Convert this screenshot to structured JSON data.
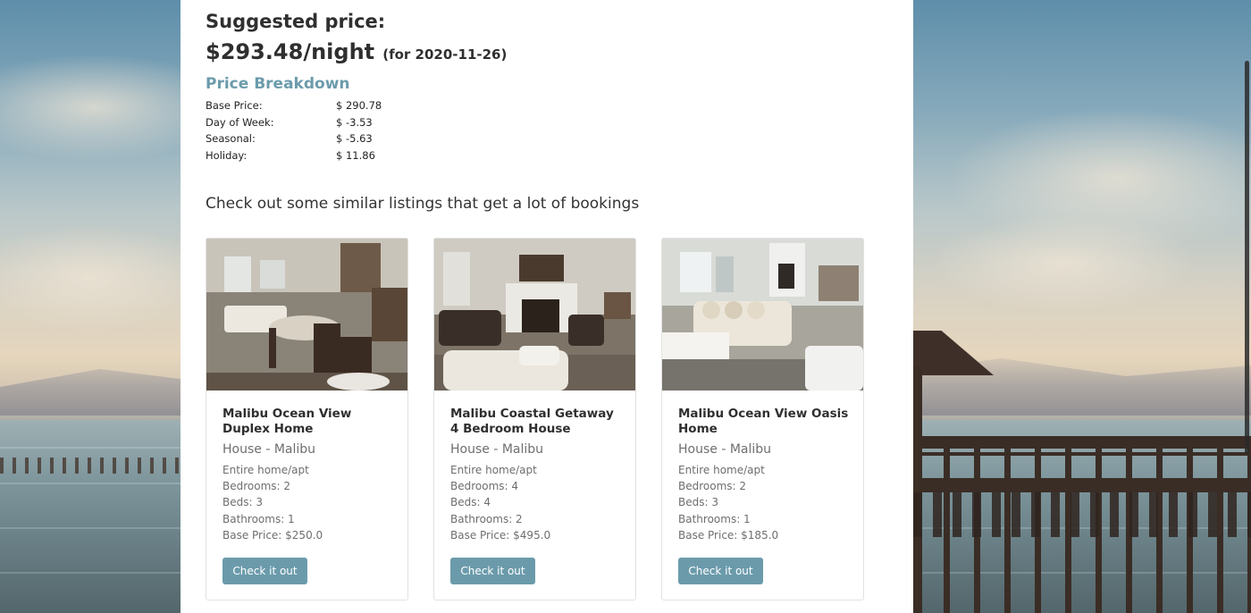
{
  "pricing": {
    "suggested_label": "Suggested price:",
    "price": "$293.48/night",
    "date_note": "(for 2020-11-26)",
    "breakdown_title": "Price Breakdown",
    "breakdown": [
      {
        "label": "Base Price:",
        "value": "$ 290.78"
      },
      {
        "label": "Day of Week:",
        "value": "$ -3.53"
      },
      {
        "label": "Seasonal:",
        "value": "$ -5.63"
      },
      {
        "label": "Holiday:",
        "value": "$ 11.86"
      }
    ]
  },
  "similar": {
    "heading": "Check out some similar listings that get a lot of bookings",
    "listings": [
      {
        "title": "Malibu Ocean View Duplex Home",
        "subtitle": "House - Malibu",
        "room_type": "Entire home/apt",
        "bedrooms": "Bedrooms: 2",
        "beds": "Beds: 3",
        "bathrooms": "Bathrooms: 1",
        "base_price": "Base Price: $250.0",
        "button_label": "Check it out"
      },
      {
        "title": "Malibu Coastal Getaway 4 Bedroom House",
        "subtitle": "House - Malibu",
        "room_type": "Entire home/apt",
        "bedrooms": "Bedrooms: 4",
        "beds": "Beds: 4",
        "bathrooms": "Bathrooms: 2",
        "base_price": "Base Price: $495.0",
        "button_label": "Check it out"
      },
      {
        "title": "Malibu Ocean View Oasis Home",
        "subtitle": "House - Malibu",
        "room_type": "Entire home/apt",
        "bedrooms": "Bedrooms: 2",
        "beds": "Beds: 3",
        "bathrooms": "Bathrooms: 1",
        "base_price": "Base Price: $185.0",
        "button_label": "Check it out"
      }
    ]
  },
  "colors": {
    "accent": "#6b9bab",
    "text_dark": "#2f2f2f",
    "text_muted": "#6e6e6e"
  }
}
